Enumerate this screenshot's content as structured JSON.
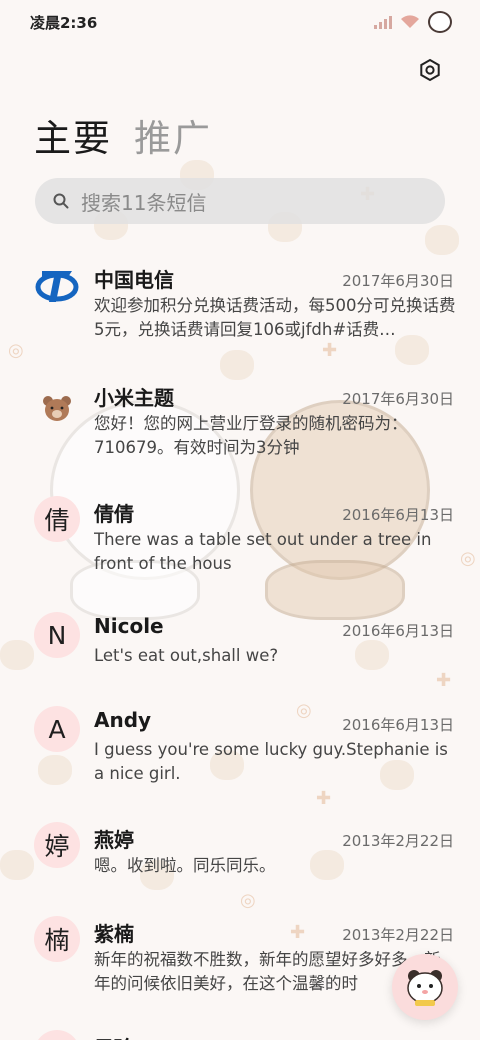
{
  "status_bar": {
    "time": "凌晨2:36",
    "icons": [
      "signal-icon",
      "wifi-icon",
      "bear-avatar-icon"
    ]
  },
  "header": {
    "settings_icon": "gear-icon",
    "tabs": [
      {
        "label": "主要",
        "active": true
      },
      {
        "label": "推广",
        "active": false
      }
    ]
  },
  "search": {
    "placeholder": "搜索11条短信",
    "icon": "search-icon"
  },
  "messages": [
    {
      "avatar_type": "logo",
      "avatar_text": "",
      "name": "中国电信",
      "date": "2017年6月30日",
      "preview": "欢迎参加积分兑换话费活动，每500分可兑换话费5元，兑换话费请回复106或jfdh#话费…"
    },
    {
      "avatar_type": "bear",
      "avatar_text": "",
      "name": "小米主题",
      "date": "2017年6月30日",
      "preview": "您好！您的网上营业厅登录的随机密码为：710679。有效时间为3分钟"
    },
    {
      "avatar_type": "letter",
      "avatar_text": "倩",
      "name": "倩倩",
      "date": "2016年6月13日",
      "preview": "There was a table set out under a tree in front of the hous"
    },
    {
      "avatar_type": "letter",
      "avatar_text": "N",
      "name": "Nicole",
      "date": "2016年6月13日",
      "preview": "Let's eat out,shall we?"
    },
    {
      "avatar_type": "letter",
      "avatar_text": "A",
      "name": "Andy",
      "date": "2016年6月13日",
      "preview": "I guess you're some lucky guy.Stephanie is a nice girl."
    },
    {
      "avatar_type": "letter",
      "avatar_text": "婷",
      "name": "燕婷",
      "date": "2013年2月22日",
      "preview": "嗯。收到啦。同乐同乐。"
    },
    {
      "avatar_type": "letter",
      "avatar_text": "楠",
      "name": "紫楠",
      "date": "2013年2月22日",
      "preview": "新年的祝福数不胜数，新年的愿望好多好多，新年的问候依旧美好，在这个温馨的时"
    },
    {
      "avatar_type": "letter",
      "avatar_text": "",
      "name": "子玲",
      "date": "",
      "preview": ""
    }
  ],
  "fab": {
    "icon": "compose-bear-icon"
  },
  "colors": {
    "background": "#fbf7f5",
    "avatar_bg": "#fde2e2",
    "search_bg": "#e1e1e1",
    "telecom_blue": "#1565c0"
  }
}
